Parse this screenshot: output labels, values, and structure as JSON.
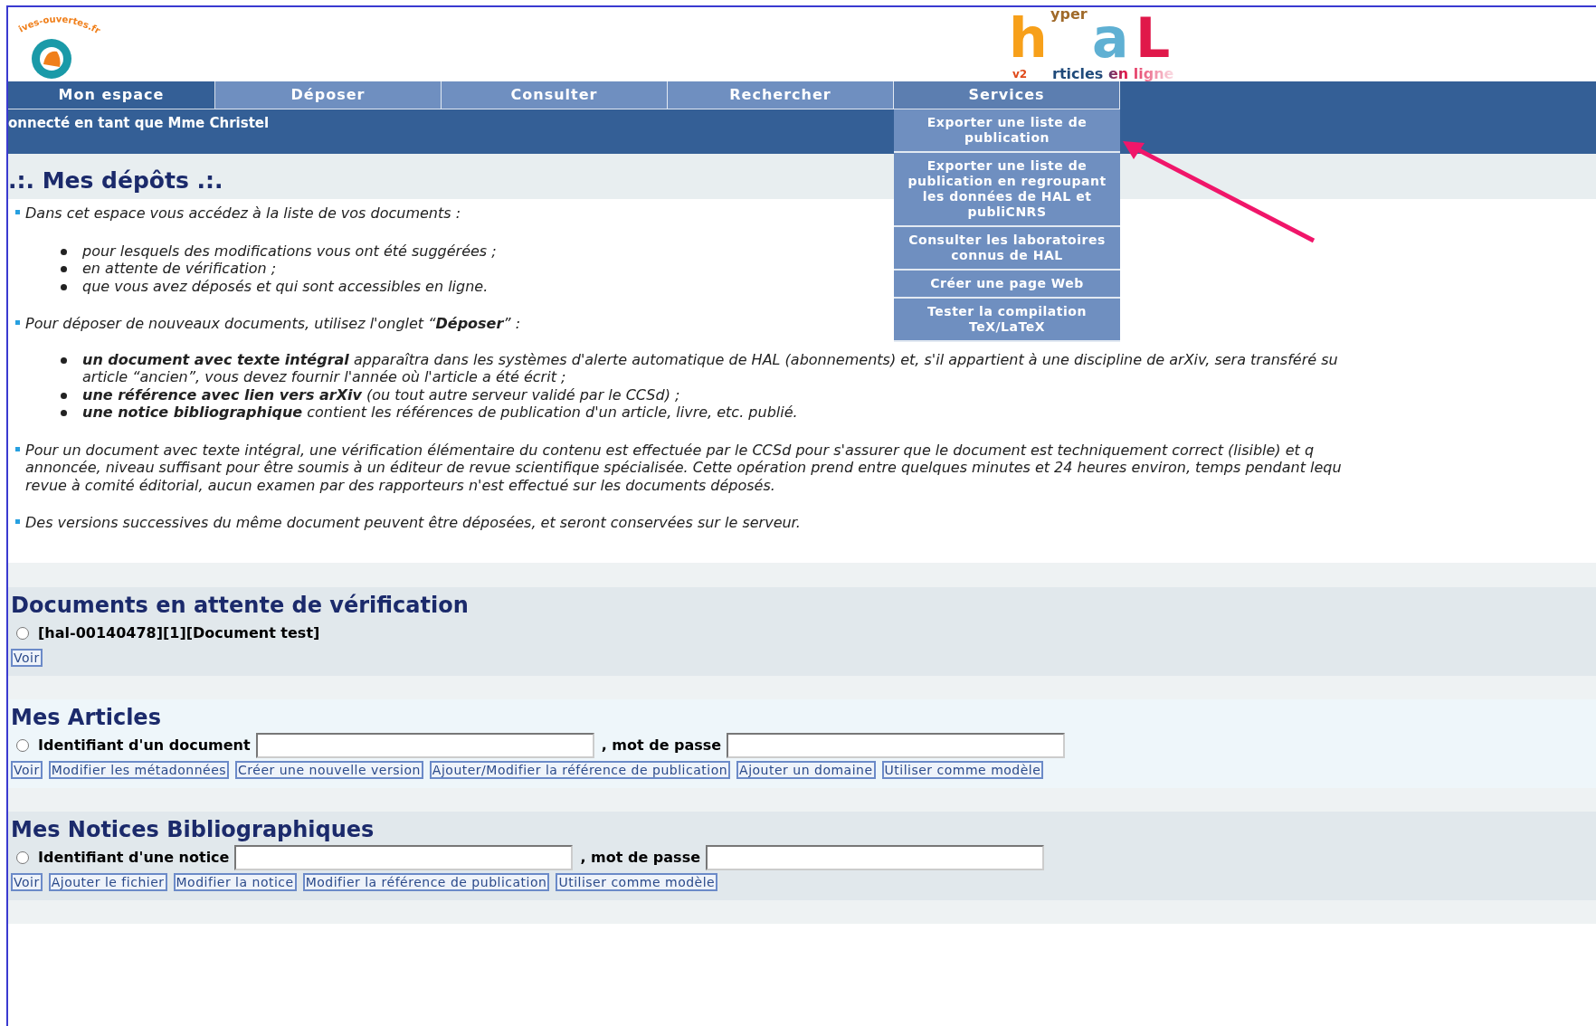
{
  "header": {
    "site_logo": {
      "text": "ives-ouvertes.fr"
    },
    "hal_logo": {
      "top": "yper",
      "h": "h",
      "a": "a",
      "l": "L",
      "bottom": "rticles en ligne",
      "version": "v2"
    }
  },
  "nav": {
    "tabs": [
      {
        "label": "Mon espace",
        "selected": true,
        "expanded": false
      },
      {
        "label": "Déposer",
        "selected": false,
        "expanded": false
      },
      {
        "label": "Consulter",
        "selected": false,
        "expanded": false
      },
      {
        "label": "Rechercher",
        "selected": false,
        "expanded": false
      },
      {
        "label": "Services",
        "selected": false,
        "expanded": true
      }
    ],
    "menu_items": [
      "Exporter une liste de publication",
      "Exporter une liste de publication en regroupant les données de HAL et publiCNRS",
      "Consulter les laboratoires connus de HAL",
      "Créer une page Web",
      "Tester la compilation TeX/LaTeX"
    ],
    "user_line": "onnecté en tant que Mme Christel"
  },
  "intro": {
    "title": ".:. Mes dépôts .:.",
    "blocks": [
      {
        "kind": "para",
        "lines": [
          "Dans cet espace vous accédez à la liste de vos documents :"
        ]
      },
      {
        "kind": "list",
        "items": [
          [
            "pour lesquels des modifications vous ont été suggérées ;"
          ],
          [
            "en attente de vérification ;"
          ],
          [
            "que vous avez déposés et qui sont accessibles en ligne."
          ]
        ]
      },
      {
        "kind": "para",
        "lines": [
          "Pour déposer de nouveaux documents, utilisez l'onglet “**Déposer**” :"
        ]
      },
      {
        "kind": "list",
        "items": [
          [
            "**un document avec texte intégral** apparaîtra dans les systèmes d'alerte automatique de HAL (abonnements) et, s'il appartient à une discipline de arXiv, sera transféré su",
            "article “ancien”, vous devez fournir l'année où l'article a été écrit ;"
          ],
          [
            "**une référence avec lien vers arXiv** (ou tout autre serveur validé par le CCSd) ;"
          ],
          [
            "**une notice bibliographique** contient les références de publication d'un article, livre, etc. publié."
          ]
        ]
      },
      {
        "kind": "para",
        "lines": [
          "Pour un document avec texte intégral, une vérification élémentaire du contenu est effectuée par le CCSd pour s'assurer que le document est techniquement correct (lisible) et q",
          "annoncée, niveau suffisant pour être soumis à un éditeur de revue scientifique spécialisée. Cette opération prend entre quelques minutes et 24 heures environ, temps pendant lequ",
          "revue à comité éditorial, aucun examen par des rapporteurs n'est effectué sur les documents déposés."
        ]
      },
      {
        "kind": "para",
        "lines": [
          "Des versions successives du même document peuvent être déposées, et seront conservées sur le serveur."
        ]
      }
    ]
  },
  "sections": [
    {
      "title": "Documents en attente de vérification",
      "kind": "pending",
      "radio": {
        "label": "[hal-00140478][1][Document test]",
        "checked": false
      },
      "buttons": [
        "Voir"
      ]
    },
    {
      "title": "Mes Articles",
      "kind": "form",
      "radio": {
        "label": "Identifiant d'un document",
        "checked": false
      },
      "password_label": ", mot de passe",
      "buttons": [
        "Voir",
        "Modifier les métadonnées",
        "Créer une nouvelle version",
        "Ajouter/Modifier la référence de publication",
        "Ajouter un domaine",
        "Utiliser comme modèle"
      ]
    },
    {
      "title": "Mes Notices Bibliographiques",
      "kind": "form",
      "radio": {
        "label": "Identifiant d'une notice",
        "checked": false
      },
      "password_label": ", mot de passe",
      "buttons": [
        "Voir",
        "Ajouter le fichier",
        "Modifier la notice",
        "Modifier la référence de publication",
        "Utiliser comme modèle"
      ]
    }
  ]
}
